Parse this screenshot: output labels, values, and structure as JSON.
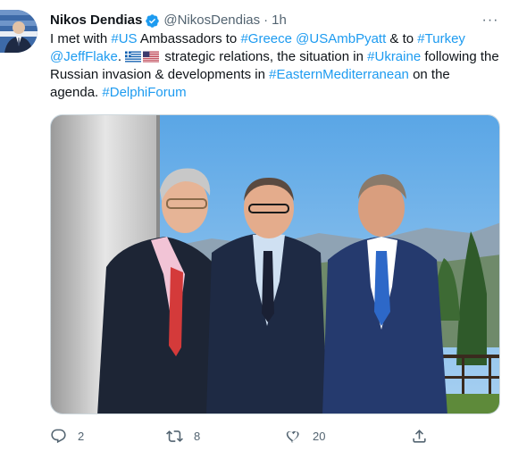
{
  "tweet": {
    "author_name": "Nikos Dendias",
    "handle": "@NikosDendias",
    "separator": "·",
    "time": "1h",
    "more_label": "···",
    "text": {
      "p1": "I met with ",
      "tag_us": "#US",
      "p2": " Ambassadors to ",
      "tag_greece": "#Greece",
      "p3": " ",
      "mention_pyatt": "@USAmbPyatt",
      "p4": " & to ",
      "tag_turkey": "#Turkey",
      "p5": " ",
      "mention_flake": "@JeffFlake",
      "p6": ". ",
      "p7": " strategic relations, the situation in ",
      "tag_ukraine": "#Ukraine",
      "p8": " following the Russian invasion & developments in ",
      "tag_eastmed": "#EasternMediterranean",
      "p9": " on the agenda. ",
      "tag_delphi": "#DelphiForum"
    },
    "flags": [
      "greek-flag-icon",
      "us-flag-icon"
    ],
    "verified_color": "#1d9bf0",
    "link_color": "#1d9bf0"
  },
  "actions": {
    "replies": "2",
    "retweets": "8",
    "likes": "20"
  }
}
